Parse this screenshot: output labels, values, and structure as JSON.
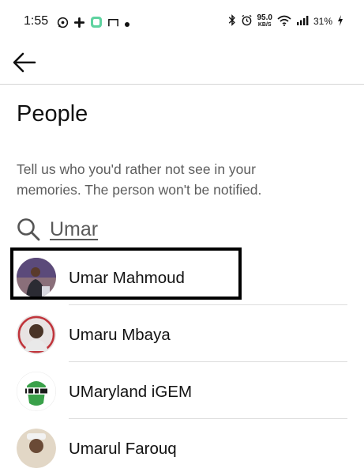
{
  "status_bar": {
    "time": "1:55",
    "net_speed_value": "95.0",
    "net_speed_unit": "KB/S",
    "battery": "31%",
    "left_icons": [
      "whatsapp-icon",
      "slack-icon",
      "app-icon",
      "window-icon",
      "dot-icon"
    ],
    "right_icons": [
      "bluetooth-icon",
      "alarm-icon",
      "wifi-icon",
      "signal-icon",
      "battery-charging-icon"
    ]
  },
  "header": {
    "back_icon": "arrow-left-icon"
  },
  "page": {
    "title": "People",
    "description": "Tell us who you'd rather not see in your memories. The person won't be notified."
  },
  "search": {
    "icon": "search-icon",
    "value": "Umar"
  },
  "people": [
    {
      "name": "Umar Mahmoud",
      "selected": true
    },
    {
      "name": "Umaru Mbaya",
      "selected": false
    },
    {
      "name": "UMaryland iGEM",
      "selected": false
    },
    {
      "name": "Umarul Farouq",
      "selected": false
    }
  ],
  "colors": {
    "text_primary": "#111111",
    "text_secondary": "#5c5c5c",
    "divider": "#d5d5d5",
    "selection_border": "#000000"
  }
}
